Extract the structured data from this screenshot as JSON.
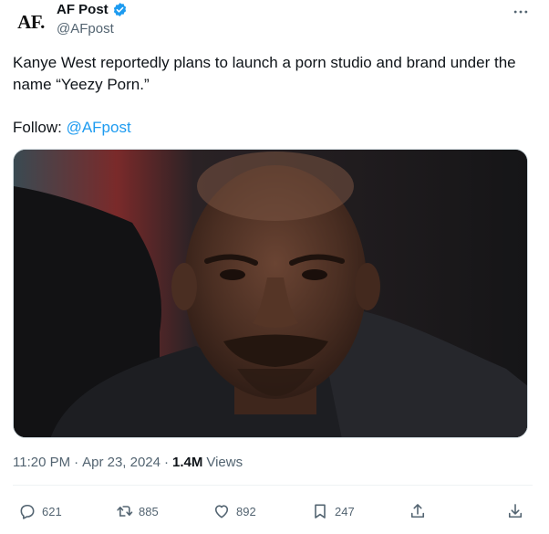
{
  "author": {
    "avatar_text": "AF.",
    "display_name": "AF Post",
    "handle": "@AFpost",
    "verified": true
  },
  "tweet": {
    "text": "Kanye West reportedly plans to launch a porn studio and brand under the name “Yeezy Porn.”",
    "follow_label": "Follow: ",
    "follow_mention": "@AFpost"
  },
  "meta": {
    "time": "11:20 PM",
    "separator1": "·",
    "date": "Apr 23, 2024",
    "separator2": "·",
    "views_count": "1.4M",
    "views_label": "Views"
  },
  "actions": {
    "replies": "621",
    "reposts": "885",
    "likes": "892",
    "bookmarks": "247"
  },
  "colors": {
    "accent": "#1d9bf0",
    "muted": "#536471",
    "text": "#0f1419",
    "verified": "#1d9bf0"
  },
  "icons": {
    "more": "ellipsis-icon",
    "reply": "reply-bubble-icon",
    "repost": "repost-arrows-icon",
    "like": "heart-icon",
    "bookmark": "bookmark-icon",
    "share": "share-upload-icon",
    "download": "download-icon"
  }
}
